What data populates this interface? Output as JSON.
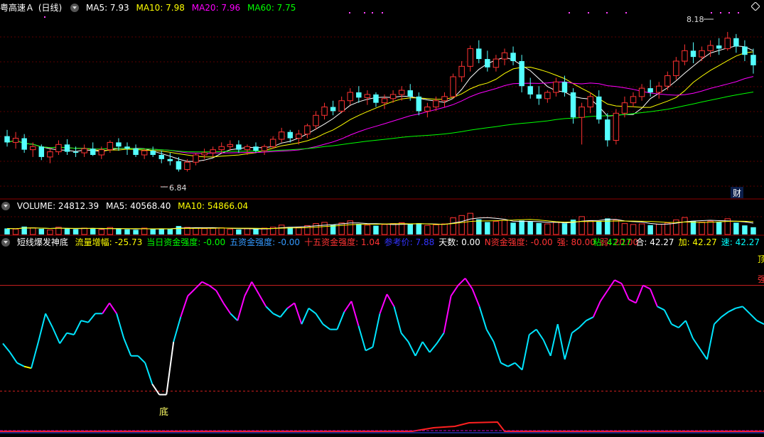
{
  "header_price": {
    "name": "粤高速Ａ",
    "period": "(日线)",
    "ma5": "MA5: 7.93",
    "ma10": "MA10: 7.98",
    "ma20": "MA20: 7.96",
    "ma60": "MA60: 7.75"
  },
  "header_volume": {
    "name": "VOLUME: 24812.39",
    "ma5": "MA5: 40568.40",
    "ma10": "MA10: 54866.04"
  },
  "header_indicator": {
    "name": "短线爆发神底",
    "items": [
      {
        "text": "流量增幅: -25.73",
        "color": "#ffff00"
      },
      {
        "text": "当日资金强度: -0.00",
        "color": "#00ff00"
      },
      {
        "text": "五资金强度: -0.00",
        "color": "#3399ff"
      },
      {
        "text": "十五资金强度: 1.04",
        "color": "#ff3333"
      },
      {
        "text": "参考价: 7.88",
        "color": "#3333ff"
      },
      {
        "text": "天数: 0.00",
        "color": "#ffffff"
      },
      {
        "text": "N资金强度: -0.00",
        "color": "#ff3333"
      },
      {
        "text": "强: 80.00",
        "color": "#ff3333"
      },
      {
        "text": "弱: 20.00",
        "color": "#ff3333"
      }
    ],
    "right_items": [
      {
        "text": "粘: 42.27",
        "color": "#00ff00"
      },
      {
        "text": "合: 42.27",
        "color": "#ffffff"
      },
      {
        "text": "加: 42.27",
        "color": "#ffff00"
      },
      {
        "text": "速: 42.27",
        "color": "#00ffff"
      }
    ],
    "right_edge_1": "顶",
    "right_edge_2": "强"
  },
  "labels": {
    "high": "8.18",
    "low": "6.84",
    "cai": "财",
    "bottom": "底"
  },
  "colors": {
    "up": "#ff3232",
    "down": "#54ffff",
    "ma5": "#ffffff",
    "ma10": "#ffff00",
    "ma20": "#ff00ff",
    "ma60": "#00ff00",
    "ind_high": "#ff00ff",
    "ind_mid": "#00e5ff",
    "ind_low": "#ffff00",
    "ind_bottom": "#ffffff"
  },
  "chart_data": {
    "type": "candlestick",
    "price_range": [
      6.7,
      8.35
    ],
    "candles": [
      [
        7.18,
        7.24,
        7.08,
        7.12
      ],
      [
        7.12,
        7.22,
        7.06,
        7.16
      ],
      [
        7.16,
        7.2,
        7.02,
        7.05
      ],
      [
        7.05,
        7.12,
        6.98,
        7.08
      ],
      [
        7.08,
        7.1,
        6.95,
        6.98
      ],
      [
        6.98,
        7.06,
        6.92,
        7.03
      ],
      [
        7.03,
        7.14,
        7.0,
        7.1
      ],
      [
        7.1,
        7.15,
        7.0,
        7.03
      ],
      [
        7.03,
        7.08,
        6.98,
        7.02
      ],
      [
        7.02,
        7.1,
        6.98,
        7.06
      ],
      [
        7.06,
        7.12,
        6.99,
        7.0
      ],
      [
        7.0,
        7.08,
        6.96,
        7.05
      ],
      [
        7.05,
        7.14,
        7.02,
        7.12
      ],
      [
        7.12,
        7.16,
        7.04,
        7.08
      ],
      [
        7.08,
        7.12,
        7.0,
        7.06
      ],
      [
        7.06,
        7.1,
        6.98,
        7.0
      ],
      [
        7.0,
        7.06,
        6.96,
        7.04
      ],
      [
        7.04,
        7.08,
        6.98,
        7.0
      ],
      [
        7.0,
        7.04,
        6.92,
        6.96
      ],
      [
        6.96,
        7.02,
        6.9,
        6.94
      ],
      [
        6.94,
        6.98,
        6.84,
        6.86
      ],
      [
        6.86,
        6.96,
        6.84,
        6.93
      ],
      [
        6.93,
        7.02,
        6.9,
        7.0
      ],
      [
        7.0,
        7.06,
        6.96,
        7.02
      ],
      [
        7.02,
        7.08,
        6.98,
        7.05
      ],
      [
        7.05,
        7.12,
        7.02,
        7.08
      ],
      [
        7.08,
        7.14,
        7.04,
        7.1
      ],
      [
        7.1,
        7.14,
        7.02,
        7.05
      ],
      [
        7.05,
        7.1,
        7.0,
        7.08
      ],
      [
        7.08,
        7.12,
        7.02,
        7.04
      ],
      [
        7.04,
        7.1,
        7.0,
        7.08
      ],
      [
        7.08,
        7.18,
        7.06,
        7.15
      ],
      [
        7.15,
        7.26,
        7.12,
        7.22
      ],
      [
        7.22,
        7.24,
        7.12,
        7.16
      ],
      [
        7.16,
        7.24,
        7.1,
        7.2
      ],
      [
        7.2,
        7.3,
        7.16,
        7.28
      ],
      [
        7.28,
        7.42,
        7.24,
        7.38
      ],
      [
        7.38,
        7.5,
        7.34,
        7.46
      ],
      [
        7.46,
        7.52,
        7.38,
        7.42
      ],
      [
        7.42,
        7.56,
        7.4,
        7.52
      ],
      [
        7.52,
        7.64,
        7.48,
        7.6
      ],
      [
        7.6,
        7.66,
        7.5,
        7.55
      ],
      [
        7.55,
        7.62,
        7.48,
        7.58
      ],
      [
        7.58,
        7.6,
        7.46,
        7.5
      ],
      [
        7.5,
        7.58,
        7.44,
        7.54
      ],
      [
        7.54,
        7.62,
        7.5,
        7.58
      ],
      [
        7.58,
        7.66,
        7.52,
        7.62
      ],
      [
        7.62,
        7.68,
        7.52,
        7.56
      ],
      [
        7.56,
        7.6,
        7.38,
        7.42
      ],
      [
        7.42,
        7.5,
        7.36,
        7.46
      ],
      [
        7.46,
        7.56,
        7.42,
        7.52
      ],
      [
        7.52,
        7.6,
        7.46,
        7.56
      ],
      [
        7.56,
        7.78,
        7.54,
        7.75
      ],
      [
        7.75,
        7.9,
        7.7,
        7.85
      ],
      [
        7.85,
        8.05,
        7.8,
        8.02
      ],
      [
        8.02,
        8.1,
        7.88,
        7.92
      ],
      [
        7.92,
        8.0,
        7.8,
        7.84
      ],
      [
        7.84,
        7.96,
        7.8,
        7.92
      ],
      [
        7.92,
        8.02,
        7.86,
        7.98
      ],
      [
        7.98,
        8.04,
        7.86,
        7.9
      ],
      [
        7.9,
        7.96,
        7.6,
        7.66
      ],
      [
        7.66,
        7.74,
        7.54,
        7.58
      ],
      [
        7.58,
        7.66,
        7.48,
        7.54
      ],
      [
        7.54,
        7.62,
        7.5,
        7.6
      ],
      [
        7.6,
        7.74,
        7.56,
        7.7
      ],
      [
        7.7,
        7.76,
        7.56,
        7.6
      ],
      [
        7.6,
        7.64,
        7.3,
        7.36
      ],
      [
        7.36,
        7.5,
        7.1,
        7.46
      ],
      [
        7.46,
        7.6,
        7.4,
        7.56
      ],
      [
        7.56,
        7.62,
        7.3,
        7.34
      ],
      [
        7.34,
        7.4,
        7.08,
        7.14
      ],
      [
        7.14,
        7.44,
        7.1,
        7.4
      ],
      [
        7.4,
        7.56,
        7.36,
        7.5
      ],
      [
        7.5,
        7.6,
        7.46,
        7.56
      ],
      [
        7.56,
        7.68,
        7.52,
        7.64
      ],
      [
        7.64,
        7.72,
        7.56,
        7.6
      ],
      [
        7.6,
        7.7,
        7.54,
        7.66
      ],
      [
        7.66,
        7.8,
        7.62,
        7.76
      ],
      [
        7.76,
        7.94,
        7.72,
        7.9
      ],
      [
        7.9,
        8.06,
        7.86,
        8.0
      ],
      [
        8.0,
        8.08,
        7.88,
        7.94
      ],
      [
        7.94,
        8.04,
        7.9,
        8.0
      ],
      [
        8.0,
        8.1,
        7.94,
        8.05
      ],
      [
        8.05,
        8.12,
        7.96,
        8.02
      ],
      [
        8.02,
        8.18,
        8.0,
        8.12
      ],
      [
        8.12,
        8.16,
        7.98,
        8.04
      ],
      [
        8.04,
        8.1,
        7.9,
        7.96
      ],
      [
        7.96,
        8.02,
        7.78,
        7.86
      ]
    ],
    "volume_range": [
      0,
      150000
    ],
    "volumes": [
      40000,
      36000,
      52000,
      44000,
      38000,
      30000,
      48000,
      41000,
      35000,
      42000,
      39000,
      33000,
      46000,
      37000,
      34000,
      31000,
      42000,
      36000,
      40000,
      38000,
      56000,
      47000,
      43000,
      39000,
      41000,
      44000,
      36000,
      33000,
      38000,
      35000,
      42000,
      48000,
      62000,
      50000,
      46000,
      58000,
      72000,
      80000,
      64000,
      76000,
      90000,
      70000,
      62000,
      58000,
      66000,
      72000,
      78000,
      68000,
      74000,
      60000,
      64000,
      70000,
      110000,
      125000,
      140000,
      100000,
      82000,
      86000,
      94000,
      78000,
      92000,
      84000,
      76000,
      70000,
      80000,
      74000,
      98000,
      118000,
      90000,
      84000,
      106000,
      96000,
      72000,
      66000,
      70000,
      62000,
      68000,
      76000,
      96000,
      112000,
      90000,
      82000,
      88000,
      84000,
      104000,
      78000,
      60000,
      48000
    ],
    "indicator_range": [
      0,
      100
    ],
    "indicator_levels": [
      80,
      20
    ],
    "indicator": [
      47,
      42,
      36,
      34,
      33,
      48,
      64,
      56,
      47,
      53,
      52,
      60,
      59,
      64,
      64,
      70,
      64,
      50,
      40,
      40,
      36,
      24,
      18,
      18,
      48,
      62,
      74,
      78,
      82,
      80,
      77,
      70,
      64,
      60,
      74,
      82,
      75,
      68,
      64,
      62,
      67,
      70,
      58,
      67,
      64,
      58,
      55,
      55,
      65,
      71,
      57,
      43,
      45,
      64,
      75,
      68,
      53,
      48,
      40,
      48,
      42,
      47,
      53,
      74,
      80,
      84,
      78,
      68,
      55,
      48,
      36,
      34,
      36,
      32,
      52,
      55,
      49,
      40,
      58,
      38,
      53,
      56,
      60,
      62,
      71,
      77,
      83,
      81,
      72,
      70,
      80,
      78,
      68,
      66,
      58,
      56,
      60,
      50,
      44,
      38,
      58,
      62,
      65,
      67,
      68,
      64,
      60,
      58
    ]
  }
}
